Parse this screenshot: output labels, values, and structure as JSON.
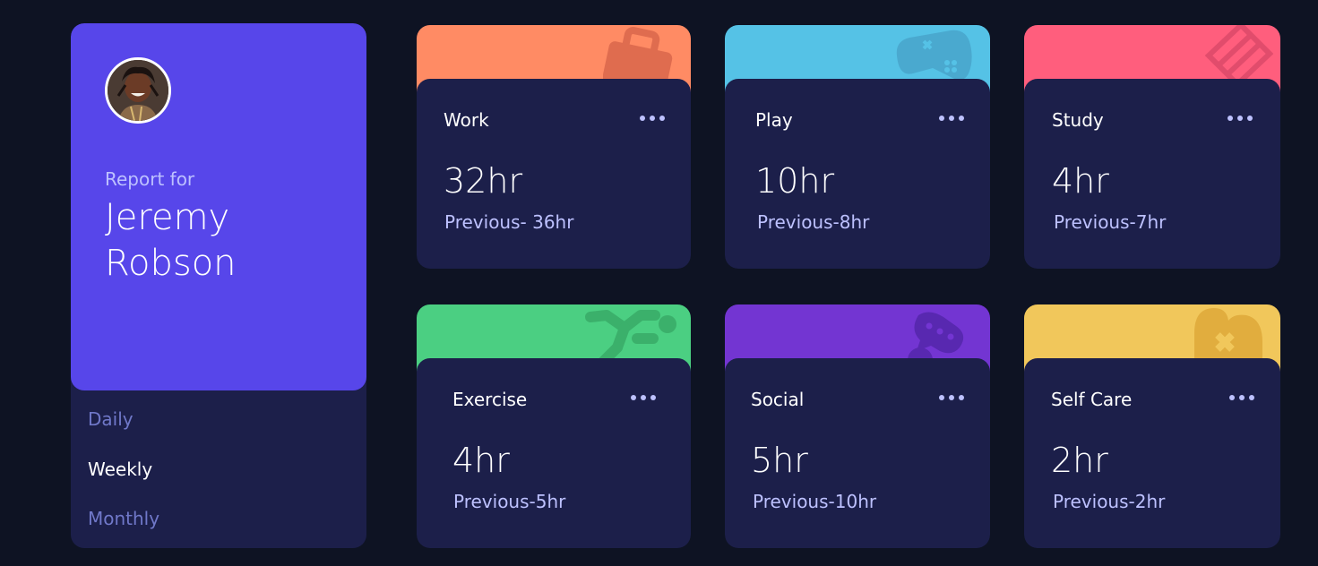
{
  "profile": {
    "report_label": "Report for",
    "name": "Jeremy Robson",
    "periods": [
      {
        "label": "Daily",
        "active": false
      },
      {
        "label": "Weekly",
        "active": true
      },
      {
        "label": "Monthly",
        "active": false
      }
    ]
  },
  "colors": {
    "background": "#0e1323",
    "card_body": "#1c1f4a",
    "profile_accent": "#5746ea",
    "muted_text": "#bdc1ff",
    "inactive_period": "#7078c9"
  },
  "cards": [
    {
      "title": "Work",
      "hours": "32hr",
      "previous": "Previous- 36hr",
      "color": "#ff8b64",
      "icon": "briefcase-icon"
    },
    {
      "title": "Play",
      "hours": "10hr",
      "previous": "Previous-8hr",
      "color": "#55c2e6",
      "icon": "gamepad-icon"
    },
    {
      "title": "Study",
      "hours": "4hr",
      "previous": "Previous-7hr",
      "color": "#ff5e7d",
      "icon": "books-icon"
    },
    {
      "title": "Exercise",
      "hours": "4hr",
      "previous": "Previous-5hr",
      "color": "#4bcf82",
      "icon": "running-icon"
    },
    {
      "title": "Social",
      "hours": "5hr",
      "previous": "Previous-10hr",
      "color": "#7335d2",
      "icon": "chat-bubble-icon"
    },
    {
      "title": "Self Care",
      "hours": "2hr",
      "previous": "Previous-2hr",
      "color": "#f1c75b",
      "icon": "heart-icon"
    }
  ]
}
